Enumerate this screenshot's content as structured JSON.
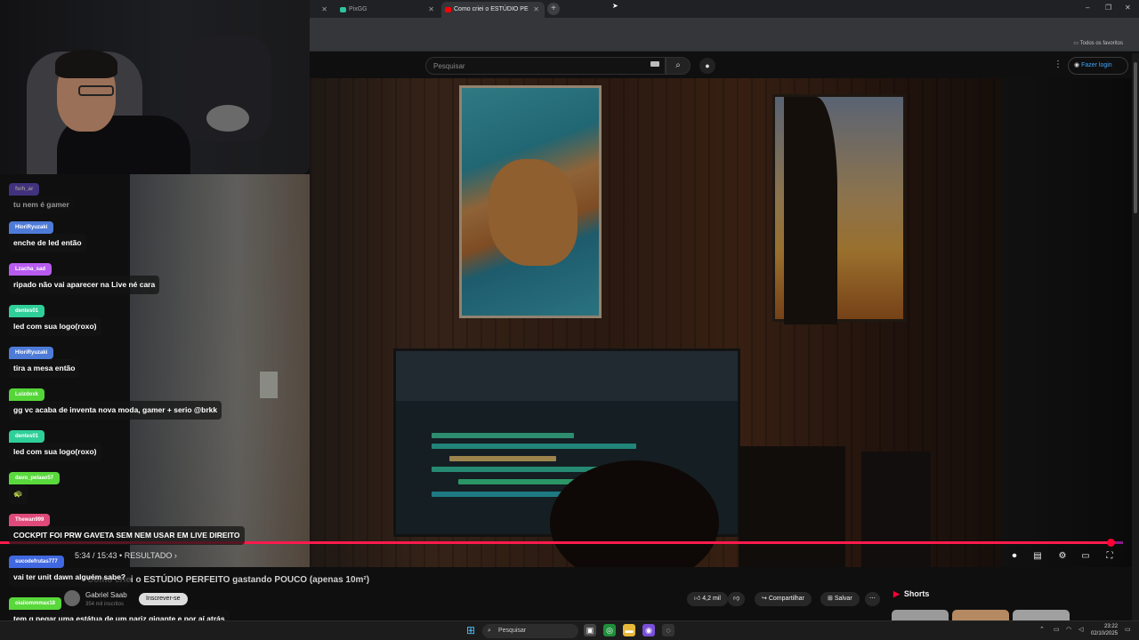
{
  "browser": {
    "tabs": [
      {
        "label": ""
      },
      {
        "label": "PixGG"
      },
      {
        "label": "Como criei o ESTÚDIO PERFEITO"
      }
    ],
    "new_tab": "+",
    "bookmarks_label": "Todos os favoritos"
  },
  "youtube": {
    "search_placeholder": "Pesquisar",
    "login_label": "Fazer login",
    "video_title": "Como criei o ESTÚDIO PERFEITO gastando POUCO (apenas 10m²)",
    "time": "5:34 / 15:43 • RESULTADO ›",
    "progress_fraction": 0.989,
    "channel_name": "Gabriel Saab",
    "channel_subs": "354 mil inscritos",
    "subscribe_label": "Inscrever-se",
    "likes": "4,2 mil",
    "share_label": "Compartilhar",
    "save_label": "Salvar",
    "shorts_label": "Shorts"
  },
  "chat": {
    "messages": [
      {
        "user": "fsrh_ar",
        "text": "tu nem é gamer",
        "color": "#6b4fd8"
      },
      {
        "user": "HloriRyuzaki",
        "text": "enche de led então",
        "color": "#4e7bd8"
      },
      {
        "user": "Lzacha_sad",
        "text": "ripado não vai aparecer na Live né cara",
        "color": "#b85cf0"
      },
      {
        "user": "dentes01",
        "text": "led com sua logo(roxo)",
        "color": "#2fcf9a"
      },
      {
        "user": "HloriRyuzaki",
        "text": "tira a mesa então",
        "color": "#4e7bd8"
      },
      {
        "user": "Luizdoxk",
        "text": "gg vc acaba de inventa nova moda, gamer + serio @brkk",
        "color": "#54d638"
      },
      {
        "user": "dentes01",
        "text": "led com sua logo(roxo)",
        "color": "#2fcf9a"
      },
      {
        "user": "davo_pelaao57",
        "text": "🐢",
        "color": "#59d93c"
      },
      {
        "user": "Thewan999",
        "text": "COCKPIT FOI PRW GAVETA SEM NEM USAR EM LIVE DIREITO",
        "color": "#e04a7a"
      },
      {
        "user": "sucodefrutas777",
        "text": "vai ter unit dawn alguém sabe?",
        "color": "#4068e0"
      },
      {
        "user": "oiaiiommmax18",
        "text": "tem q pegar uma estátua de um nariz gigante e por aí atrás",
        "color": "#58d83a"
      }
    ]
  },
  "taskbar": {
    "search_placeholder": "Pesquisar",
    "time": "23:22",
    "date": "02/10/2025"
  }
}
